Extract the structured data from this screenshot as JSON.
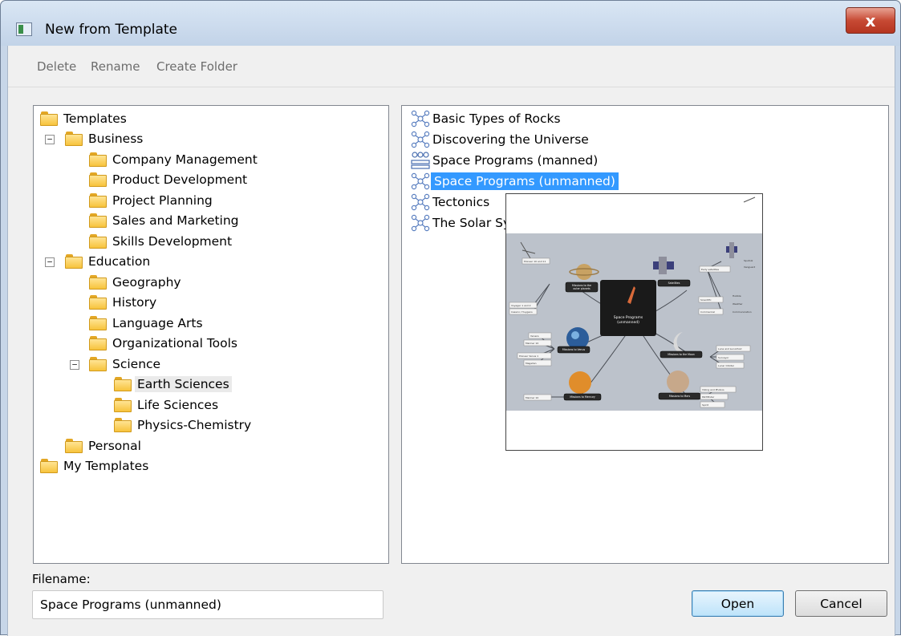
{
  "window": {
    "title": "New from Template",
    "close_glyph": "x"
  },
  "toolbar": {
    "delete": "Delete",
    "rename": "Rename",
    "create_folder": "Create Folder"
  },
  "tree": {
    "templates": "Templates",
    "business": "Business",
    "company_management": "Company Management",
    "product_development": "Product Development",
    "project_planning": "Project Planning",
    "sales_and_marketing": "Sales and Marketing",
    "skills_development": "Skills Development",
    "education": "Education",
    "geography": "Geography",
    "history": "History",
    "language_arts": "Language Arts",
    "organizational_tools": "Organizational Tools",
    "science": "Science",
    "earth_sciences": "Earth Sciences",
    "life_sciences": "Life Sciences",
    "physics_chemistry": "Physics-Chemistry",
    "personal": "Personal",
    "my_templates": "My Templates",
    "collapse_glyph": "−"
  },
  "templates": {
    "items": [
      "Basic Types of Rocks",
      "Discovering the Universe",
      "Space Programs (manned)",
      "Space Programs (unmanned)",
      "Tectonics",
      "The Solar Sy"
    ],
    "selected_index": 3
  },
  "preview": {
    "central": [
      "Space Programs",
      "(unmanned)"
    ],
    "topics": {
      "outer_planets": [
        "Missions to the",
        "outer planets"
      ],
      "satellites": "Satellites",
      "venus": "Missions to Venus",
      "moon": "Missions to the Moon",
      "mercury": "Missions to Mercury",
      "asteroid": "Missions to Mars"
    },
    "sub": {
      "op1": "Pioneer 10 and 11",
      "op2": "Voyager 1 and 2",
      "op3": "Cassini / Huygens",
      "sat1": "Early satellites",
      "sat2": "Sputnik",
      "sat3": "Vanguard",
      "sat4": "Scientific",
      "sat5": "Hubble",
      "sat6": "Weather",
      "sat7": "Commercial",
      "sat8": "Military",
      "sat9": "Communication",
      "v1": "Venera",
      "v2": "Mariner 10",
      "v3": "Pioneer Venus 1",
      "v4": "Magellan",
      "m1": "Luna and Lunokhod",
      "m2": "Surveyor",
      "m3": "Lunar Orbiter",
      "me1": "Mariner 10",
      "ma1": "Viking and Phobos",
      "ma2": "Pathfinder",
      "ma3": "Spirit"
    }
  },
  "filename": {
    "label": "Filename:",
    "value": "Space Programs (unmanned)"
  },
  "buttons": {
    "open": "Open",
    "cancel": "Cancel"
  }
}
